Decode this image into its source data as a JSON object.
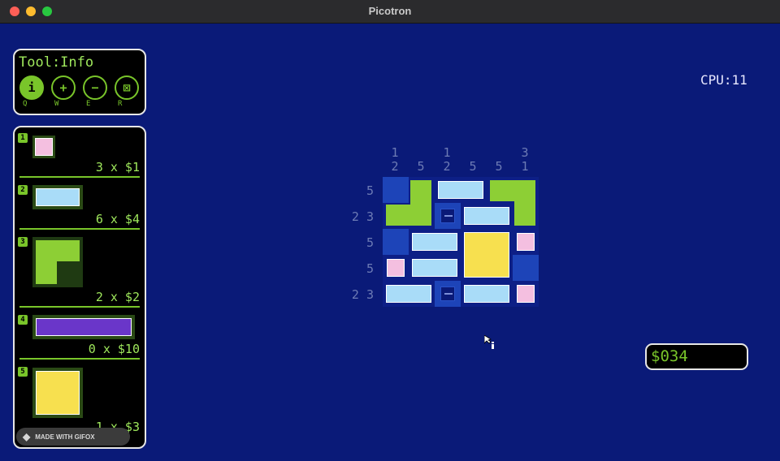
{
  "window": {
    "title": "Picotron"
  },
  "tool_panel": {
    "title": "Tool:Info",
    "tools": [
      {
        "glyph": "i",
        "key": "Q"
      },
      {
        "glyph": "+",
        "key": "W"
      },
      {
        "glyph": "−",
        "key": "E"
      },
      {
        "glyph": "⊠",
        "key": "R"
      }
    ]
  },
  "inventory": [
    {
      "num": "1",
      "qty": "3 x $1",
      "color": "#f4bfe0"
    },
    {
      "num": "2",
      "qty": "6 x $4",
      "color": "#a9dcf8"
    },
    {
      "num": "3",
      "qty": "2 x $2",
      "color": "#8dcf35"
    },
    {
      "num": "4",
      "qty": "0 x $10",
      "color": "#6a36c9"
    },
    {
      "num": "5",
      "qty": "1 x $3",
      "color": "#f7e04f"
    }
  ],
  "cpu": "CPU:11",
  "puzzle": {
    "column_clues": [
      [
        "1",
        "2"
      ],
      [
        "5"
      ],
      [
        "1",
        "2"
      ],
      [
        "5"
      ],
      [
        "5"
      ],
      [
        "3",
        "1"
      ]
    ],
    "row_clues": [
      "5",
      "2 3",
      "5",
      "5",
      "2 3"
    ]
  },
  "money": "$034",
  "watermark": "MADE WITH GIFOX"
}
